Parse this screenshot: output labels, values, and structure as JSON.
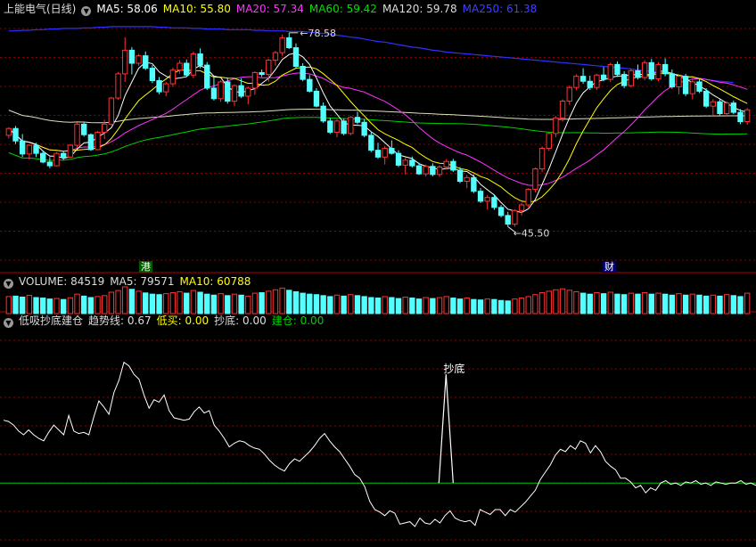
{
  "header": {
    "title": "上能电气(日线)",
    "ma": [
      {
        "label": "MA5: 58.06",
        "color": "#ffffff"
      },
      {
        "label": "MA10: 55.80",
        "color": "#ffff00"
      },
      {
        "label": "MA20: 57.34",
        "color": "#ff33ff"
      },
      {
        "label": "MA60: 59.42",
        "color": "#00e000"
      },
      {
        "label": "MA120: 59.78",
        "color": "#dddddd"
      },
      {
        "label": "MA250: 61.38",
        "color": "#4040ff"
      }
    ]
  },
  "price_annotations": {
    "high": "78.58",
    "low": "45.50"
  },
  "tags": {
    "left": "港",
    "right": "财"
  },
  "volume_header": {
    "volume": "VOLUME: 84519",
    "ma5": "MA5: 79571",
    "ma10": "MA10: 60788"
  },
  "indicator_header": {
    "name": "低吸抄底建仓",
    "trend": "趋势线: 0.67",
    "low_buy": "低买: 0.00",
    "bottom": "抄底: 0.00",
    "build": "建仓: 0.00"
  },
  "indicator_label": "抄底",
  "colors": {
    "up": "#ff3333",
    "down": "#54ffff",
    "grid": "#8b0000",
    "ma5": "#ffffff",
    "ma10": "#ffff00",
    "ma20": "#ff33ff",
    "ma60": "#00d000",
    "ma120": "#e0e0c0",
    "ma250": "#3030ff",
    "trend": "#ffffff",
    "zero": "#00c000"
  },
  "chart_data": {
    "type": "candlestick",
    "price_range": [
      43,
      82
    ],
    "candles": [
      [
        62.8,
        64.1,
        62.3,
        63.9
      ],
      [
        63.9,
        64.3,
        61.4,
        61.9
      ],
      [
        61.9,
        63.0,
        59.3,
        59.8
      ],
      [
        59.8,
        61.4,
        58.9,
        61.2
      ],
      [
        61.2,
        61.6,
        59.3,
        59.9
      ],
      [
        59.9,
        60.4,
        58.3,
        58.5
      ],
      [
        58.5,
        59.3,
        57.5,
        57.9
      ],
      [
        57.9,
        60.1,
        57.8,
        59.9
      ],
      [
        59.9,
        60.3,
        58.8,
        59.3
      ],
      [
        59.3,
        61.4,
        59.2,
        61.2
      ],
      [
        61.2,
        64.8,
        60.8,
        64.6
      ],
      [
        64.6,
        64.9,
        62.6,
        62.9
      ],
      [
        62.9,
        63.1,
        60.3,
        60.5
      ],
      [
        60.5,
        63.5,
        60.4,
        63.3
      ],
      [
        63.3,
        65.3,
        62.2,
        64.6
      ],
      [
        64.6,
        69.0,
        64.4,
        68.8
      ],
      [
        68.8,
        73.0,
        68.5,
        72.7
      ],
      [
        72.7,
        78.58,
        71.4,
        76.5
      ],
      [
        76.5,
        77.0,
        72.6,
        74.4
      ],
      [
        74.4,
        75.9,
        74.0,
        75.6
      ],
      [
        75.6,
        76.3,
        73.3,
        73.6
      ],
      [
        73.6,
        74.1,
        71.2,
        71.6
      ],
      [
        71.6,
        72.2,
        69.4,
        69.8
      ],
      [
        69.8,
        71.4,
        69.1,
        71.1
      ],
      [
        71.1,
        73.7,
        70.6,
        73.3
      ],
      [
        73.3,
        74.9,
        72.7,
        74.4
      ],
      [
        74.4,
        75.0,
        72.2,
        72.5
      ],
      [
        72.5,
        76.3,
        72.0,
        75.9
      ],
      [
        75.9,
        76.8,
        73.6,
        74.1
      ],
      [
        74.1,
        74.6,
        70.1,
        70.4
      ],
      [
        70.4,
        72.3,
        68.4,
        68.7
      ],
      [
        68.7,
        71.7,
        68.2,
        71.4
      ],
      [
        71.4,
        72.1,
        67.9,
        68.3
      ],
      [
        68.3,
        71.0,
        67.5,
        70.8
      ],
      [
        70.8,
        72.0,
        68.8,
        69.1
      ],
      [
        69.1,
        70.7,
        67.8,
        70.4
      ],
      [
        70.4,
        73.1,
        69.3,
        72.9
      ],
      [
        72.9,
        73.4,
        72.2,
        72.6
      ],
      [
        72.6,
        75.1,
        71.4,
        74.9
      ],
      [
        74.9,
        76.4,
        74.0,
        76.1
      ],
      [
        76.1,
        79.0,
        75.6,
        78.5
      ],
      [
        78.5,
        79.3,
        76.7,
        76.9
      ],
      [
        76.9,
        77.6,
        73.6,
        73.9
      ],
      [
        73.9,
        74.4,
        71.5,
        71.8
      ],
      [
        71.8,
        72.5,
        69.7,
        69.9
      ],
      [
        69.9,
        70.4,
        67.3,
        67.5
      ],
      [
        67.5,
        68.1,
        64.8,
        65.1
      ],
      [
        65.1,
        65.6,
        63.0,
        63.3
      ],
      [
        63.3,
        65.4,
        62.5,
        65.1
      ],
      [
        65.1,
        65.5,
        62.8,
        63.1
      ],
      [
        63.1,
        65.9,
        62.8,
        65.7
      ],
      [
        65.7,
        66.6,
        64.6,
        64.9
      ],
      [
        64.9,
        65.4,
        62.5,
        62.8
      ],
      [
        62.8,
        63.3,
        60.1,
        60.4
      ],
      [
        60.4,
        61.6,
        59.0,
        59.3
      ],
      [
        59.3,
        61.1,
        58.1,
        60.7
      ],
      [
        60.7,
        62.0,
        59.7,
        59.9
      ],
      [
        59.9,
        60.4,
        57.7,
        58.0
      ],
      [
        58.0,
        59.2,
        56.5,
        58.8
      ],
      [
        58.8,
        59.4,
        57.6,
        57.9
      ],
      [
        57.9,
        58.4,
        56.4,
        56.6
      ],
      [
        56.6,
        58.1,
        56.2,
        57.8
      ],
      [
        57.8,
        58.3,
        56.2,
        56.5
      ],
      [
        56.5,
        58.0,
        56.1,
        57.7
      ],
      [
        57.7,
        59.0,
        57.3,
        58.6
      ],
      [
        58.6,
        59.0,
        56.9,
        57.2
      ],
      [
        57.2,
        57.7,
        55.1,
        55.4
      ],
      [
        55.4,
        56.4,
        54.3,
        56.0
      ],
      [
        56.0,
        56.5,
        53.5,
        53.8
      ],
      [
        53.8,
        54.3,
        51.9,
        52.2
      ],
      [
        52.2,
        53.2,
        50.9,
        52.8
      ],
      [
        52.8,
        53.3,
        50.8,
        51.2
      ],
      [
        51.2,
        51.6,
        49.6,
        49.9
      ],
      [
        49.9,
        50.5,
        48.1,
        48.5
      ],
      [
        48.5,
        50.9,
        48.1,
        50.7
      ],
      [
        50.7,
        51.9,
        49.9,
        51.6
      ],
      [
        51.6,
        54.3,
        51.2,
        54.1
      ],
      [
        54.1,
        57.6,
        53.6,
        57.4
      ],
      [
        57.4,
        61.0,
        56.9,
        60.7
      ],
      [
        60.7,
        63.4,
        60.3,
        63.1
      ],
      [
        63.1,
        65.9,
        62.5,
        65.6
      ],
      [
        65.6,
        68.6,
        65.0,
        68.3
      ],
      [
        68.3,
        70.8,
        67.7,
        70.5
      ],
      [
        70.5,
        72.6,
        70.1,
        72.3
      ],
      [
        72.3,
        73.6,
        71.1,
        71.5
      ],
      [
        71.5,
        72.4,
        70.1,
        70.5
      ],
      [
        70.5,
        72.7,
        70.1,
        72.5
      ],
      [
        72.5,
        73.8,
        71.5,
        71.8
      ],
      [
        71.8,
        74.5,
        71.4,
        74.2
      ],
      [
        74.2,
        74.7,
        72.2,
        72.6
      ],
      [
        72.6,
        73.1,
        70.4,
        70.8
      ],
      [
        70.8,
        73.5,
        70.5,
        73.2
      ],
      [
        73.2,
        74.2,
        71.8,
        72.1
      ],
      [
        72.1,
        74.9,
        71.7,
        74.5
      ],
      [
        74.5,
        75.1,
        71.6,
        71.9
      ],
      [
        71.9,
        74.6,
        71.5,
        74.2
      ],
      [
        74.2,
        75.2,
        72.3,
        72.7
      ],
      [
        72.7,
        73.4,
        70.3,
        70.6
      ],
      [
        70.6,
        72.5,
        69.4,
        72.3
      ],
      [
        72.3,
        72.7,
        69.1,
        69.5
      ],
      [
        69.5,
        71.8,
        68.6,
        71.4
      ],
      [
        71.4,
        71.8,
        69.6,
        69.9
      ],
      [
        69.9,
        70.4,
        67.2,
        67.5
      ],
      [
        67.5,
        68.6,
        65.8,
        68.2
      ],
      [
        68.2,
        68.6,
        66.0,
        66.3
      ],
      [
        66.3,
        68.3,
        65.8,
        68.0
      ],
      [
        68.0,
        68.4,
        66.2,
        66.5
      ],
      [
        66.5,
        67.0,
        64.6,
        65.0
      ],
      [
        65.0,
        67.2,
        64.5,
        66.9
      ]
    ],
    "ma250": [
      79.6,
      79.6,
      79.7,
      79.7,
      79.8,
      79.8,
      79.9,
      79.9,
      80.0,
      80.0,
      80.0,
      80.1,
      80.1,
      80.2,
      80.2,
      80.3,
      80.3,
      80.3,
      80.3,
      80.3,
      80.3,
      80.3,
      80.2,
      80.2,
      80.1,
      80.1,
      80.1,
      80.0,
      80.0,
      79.9,
      79.9,
      79.9,
      79.8,
      79.8,
      79.8,
      79.8,
      79.7,
      79.7,
      79.6,
      79.6,
      79.6,
      79.5,
      79.5,
      79.5,
      79.4,
      79.3,
      79.2,
      79.1,
      78.9,
      78.8,
      78.6,
      78.5,
      78.3,
      78.1,
      77.9,
      77.8,
      77.6,
      77.4,
      77.2,
      77.0,
      76.9,
      76.7,
      76.5,
      76.4,
      76.2,
      76.1,
      76.0,
      75.9,
      75.8,
      75.7,
      75.6,
      75.5,
      75.4,
      75.3,
      75.2,
      75.1,
      75.0,
      74.9,
      74.8,
      74.7,
      74.6,
      74.5,
      74.4,
      74.3,
      74.2,
      74.1,
      74.0,
      73.9,
      73.8,
      73.7,
      73.6,
      73.5,
      73.3,
      73.2,
      73.1,
      73.0,
      72.8,
      72.6,
      72.5,
      72.3,
      72.1,
      72.0,
      71.8,
      71.6,
      71.5,
      71.4,
      71.3
    ]
  },
  "volume_data": {
    "max": 200000,
    "values": [
      70,
      72,
      68,
      75,
      66,
      64,
      60,
      62,
      58,
      65,
      80,
      72,
      66,
      70,
      74,
      88,
      95,
      110,
      100,
      92,
      85,
      80,
      78,
      82,
      86,
      90,
      84,
      95,
      88,
      80,
      76,
      82,
      74,
      80,
      76,
      72,
      84,
      86,
      92,
      98,
      105,
      96,
      90,
      84,
      80,
      78,
      74,
      70,
      76,
      72,
      78,
      74,
      70,
      66,
      64,
      70,
      66,
      62,
      68,
      64,
      60,
      66,
      62,
      66,
      70,
      64,
      60,
      64,
      58,
      56,
      60,
      58,
      54,
      52,
      60,
      64,
      70,
      78,
      86,
      92,
      98,
      102,
      96,
      90,
      84,
      80,
      86,
      82,
      88,
      80,
      78,
      84,
      80,
      86,
      80,
      84,
      80,
      76,
      82,
      76,
      80,
      76,
      72,
      76,
      72,
      78,
      74,
      70,
      84
    ]
  },
  "indicator_data": {
    "range": [
      -0.5,
      1.3
    ],
    "trend": [
      0.52,
      0.51,
      0.48,
      0.43,
      0.4,
      0.44,
      0.4,
      0.37,
      0.35,
      0.42,
      0.48,
      0.44,
      0.4,
      0.56,
      0.43,
      0.41,
      0.42,
      0.4,
      0.55,
      0.68,
      0.63,
      0.57,
      0.75,
      0.85,
      1.0,
      0.97,
      0.9,
      0.86,
      0.73,
      0.62,
      0.69,
      0.67,
      0.73,
      0.6,
      0.54,
      0.53,
      0.52,
      0.53,
      0.59,
      0.63,
      0.58,
      0.6,
      0.48,
      0.43,
      0.37,
      0.3,
      0.33,
      0.35,
      0.34,
      0.31,
      0.29,
      0.28,
      0.24,
      0.19,
      0.15,
      0.12,
      0.1,
      0.16,
      0.2,
      0.18,
      0.22,
      0.26,
      0.31,
      0.37,
      0.41,
      0.35,
      0.3,
      0.26,
      0.2,
      0.14,
      0.07,
      0.04,
      -0.03,
      -0.15,
      -0.22,
      -0.24,
      -0.27,
      -0.23,
      -0.25,
      -0.34,
      -0.33,
      -0.32,
      -0.36,
      -0.29,
      -0.33,
      -0.34,
      -0.3,
      -0.33,
      -0.27,
      -0.23,
      -0.29,
      -0.31,
      -0.32,
      -0.31,
      -0.35,
      -0.22,
      -0.24,
      -0.26,
      -0.22,
      -0.22,
      -0.27,
      -0.22,
      -0.24,
      -0.2,
      -0.16,
      -0.11,
      -0.06,
      0.03,
      0.09,
      0.15,
      0.23,
      0.28,
      0.26,
      0.31,
      0.28,
      0.35,
      0.33,
      0.25,
      0.31,
      0.26,
      0.18,
      0.14,
      0.11,
      0.04,
      0.04,
      0.01,
      -0.04,
      -0.02,
      -0.08,
      -0.04,
      -0.06,
      0.0,
      0.02,
      -0.01,
      0.0,
      -0.02,
      0.01,
      0.0,
      0.02,
      -0.01,
      0.0,
      -0.02,
      0.01,
      0.0,
      -0.01,
      0.0,
      0.0,
      0.02,
      -0.01,
      0.0,
      -0.02
    ],
    "spike_pos": 0.59,
    "spike_value": 0.9
  }
}
